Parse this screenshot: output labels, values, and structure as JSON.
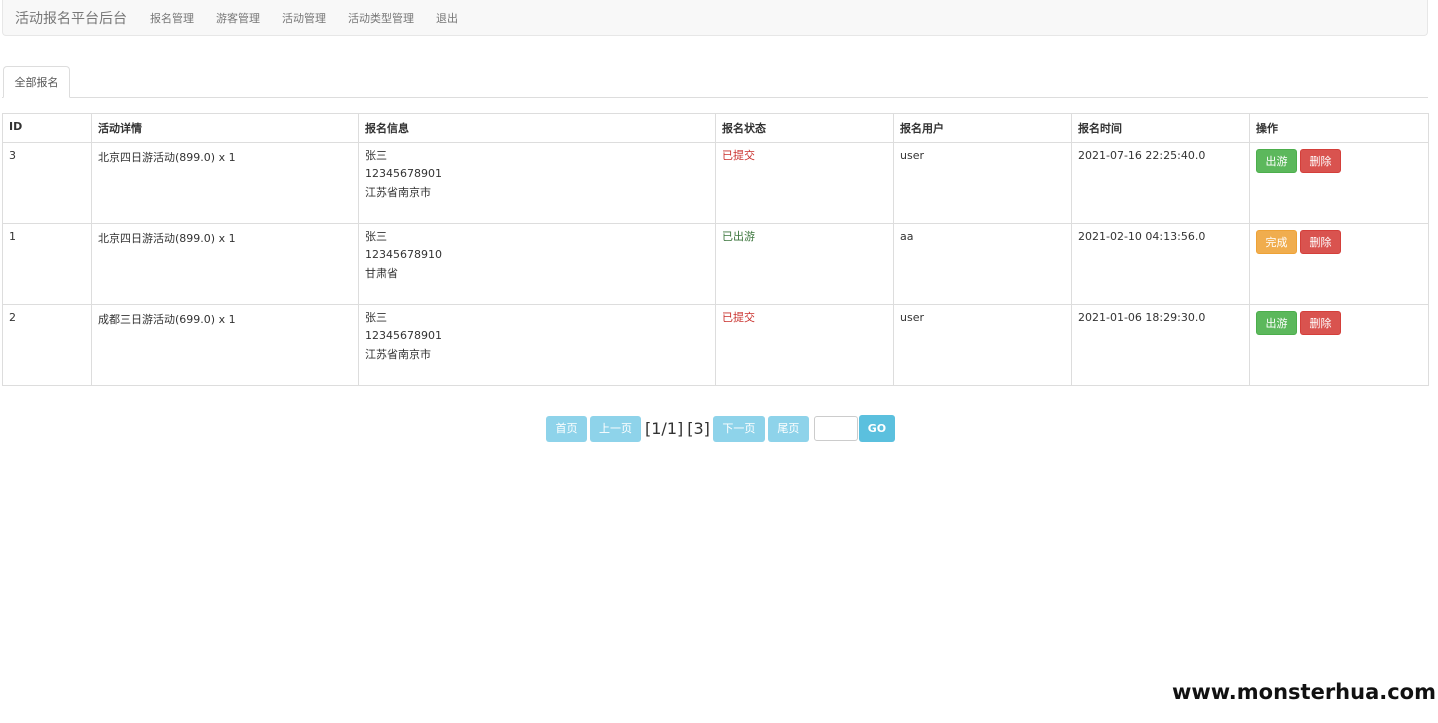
{
  "navbar": {
    "brand": "活动报名平台后台",
    "items": [
      "报名管理",
      "游客管理",
      "活动管理",
      "活动类型管理",
      "退出"
    ]
  },
  "tabs": [
    "全部报名"
  ],
  "table": {
    "headers": [
      "ID",
      "活动详情",
      "报名信息",
      "报名状态",
      "报名用户",
      "报名时间",
      "操作"
    ],
    "rows": [
      {
        "id": "3",
        "activity": "北京四日游活动(899.0) x 1",
        "info": [
          "张三",
          "12345678901",
          "江苏省南京市"
        ],
        "status": "已提交",
        "user": "user",
        "time": "2021-07-16 22:25:40.0",
        "action_primary": "出游",
        "action_delete": "删除"
      },
      {
        "id": "1",
        "activity": "北京四日游活动(899.0) x 1",
        "info": [
          "张三",
          "12345678910",
          "甘肃省"
        ],
        "status": "已出游",
        "user": "aa",
        "time": "2021-02-10 04:13:56.0",
        "action_primary": "完成",
        "action_delete": "删除"
      },
      {
        "id": "2",
        "activity": "成都三日游活动(699.0) x 1",
        "info": [
          "张三",
          "12345678901",
          "江苏省南京市"
        ],
        "status": "已提交",
        "user": "user",
        "time": "2021-01-06 18:29:30.0",
        "action_primary": "出游",
        "action_delete": "删除"
      }
    ]
  },
  "pager": {
    "first": "首页",
    "prev": "上一页",
    "page_info": "[1/1]",
    "total": "[3]",
    "next": "下一页",
    "last": "尾页",
    "page_input": "",
    "go": "GO"
  },
  "watermark": "www.monsterhua.com",
  "colors": {
    "status_submitted": "#c9302c",
    "status_traveled": "#3c763d",
    "success": "#5cb85c",
    "danger": "#d9534f",
    "warning": "#f0ad4e",
    "pager_disabled": "#8ed3ea",
    "go": "#5bc0de"
  }
}
